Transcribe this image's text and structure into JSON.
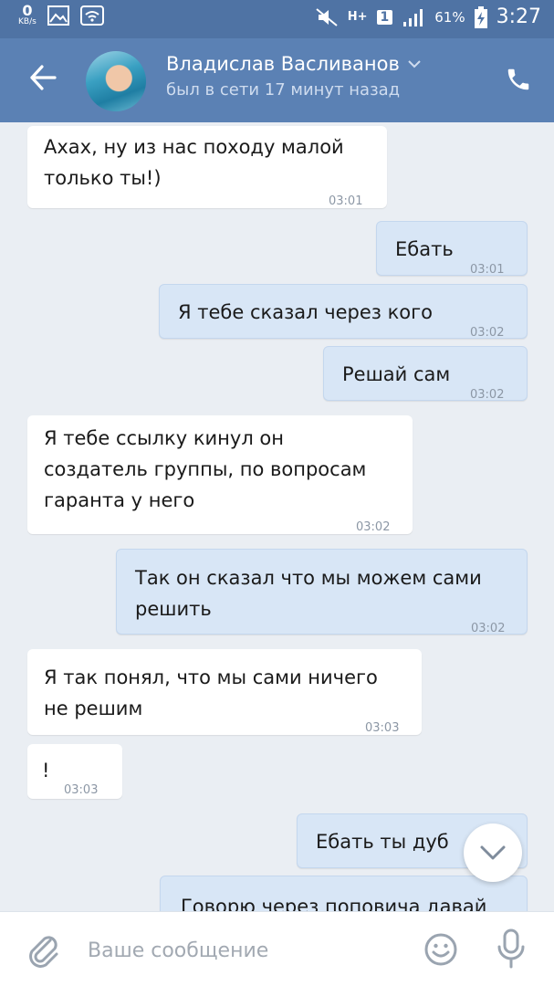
{
  "statusbar": {
    "speed_value": "0",
    "speed_unit": "KB/s",
    "network": "H+",
    "sim": "1",
    "battery": "61%",
    "time": "3:27"
  },
  "header": {
    "name": "Владислав Васливанов",
    "status": "был в сети 17 минут назад"
  },
  "messages": [
    {
      "dir": "in",
      "text": "Ахах, ну из нас походу малой\nтолько ты!)",
      "time": "03:01"
    },
    {
      "dir": "out",
      "text": "Ебать",
      "time": "03:01"
    },
    {
      "dir": "out",
      "text": "Я тебе сказал через кого",
      "time": "03:02"
    },
    {
      "dir": "out",
      "text": "Решай сам",
      "time": "03:02"
    },
    {
      "dir": "in",
      "text": "Я тебе ссылку кинул он\nсоздатель группы, по вопросам\nгаранта у него",
      "time": "03:02"
    },
    {
      "dir": "out",
      "text": "Так он сказал что мы можем сами\nрешить",
      "time": "03:02"
    },
    {
      "dir": "in",
      "text": "Я так понял, что мы сами ничего\nне решим",
      "time": "03:03"
    },
    {
      "dir": "in",
      "text": "!",
      "time": "03:03"
    },
    {
      "dir": "out",
      "text": "Ебать ты дуб",
      "time": ""
    },
    {
      "dir": "out",
      "text": "Говорю через поповича давай",
      "time": ""
    }
  ],
  "composer": {
    "placeholder": "Ваше сообщение"
  },
  "colors": {
    "header": "#5b81b4",
    "statusbar": "#4f73a4",
    "chat_bg": "#eaeef3",
    "outgoing_bubble": "#d8e6f6",
    "incoming_bubble": "#ffffff"
  },
  "icons": {
    "back": "arrow-left-icon",
    "call": "phone-icon",
    "dropdown": "chevron-down-icon",
    "attach": "paperclip-icon",
    "emoji": "smiley-icon",
    "mic": "microphone-icon",
    "scroll": "chevron-down-icon"
  }
}
